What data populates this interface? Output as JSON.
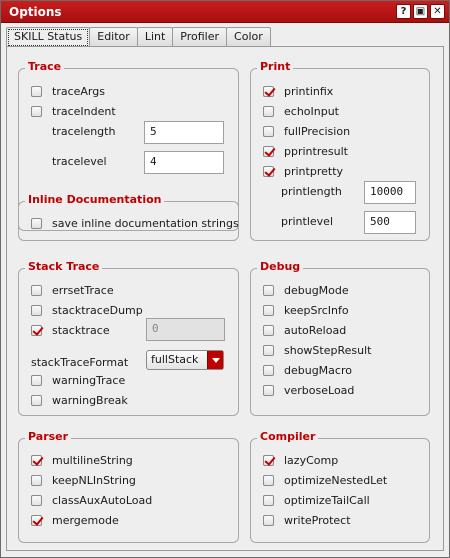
{
  "window": {
    "title": "Options",
    "help_icon": "?",
    "restore_icon": "restore-icon",
    "close_icon": "close-icon"
  },
  "tabs": [
    "SKILL Status",
    "Editor",
    "Lint",
    "Profiler",
    "Color"
  ],
  "trace": {
    "title": "Trace",
    "traceArgs": "traceArgs",
    "traceIndent": "traceIndent",
    "tracelength_label": "tracelength",
    "tracelength_value": "5",
    "tracelevel_label": "tracelevel",
    "tracelevel_value": "4"
  },
  "print": {
    "title": "Print",
    "printinfix": "printinfix",
    "echoInput": "echoInput",
    "fullPrecision": "fullPrecision",
    "pprintresult": "pprintresult",
    "printpretty": "printpretty",
    "printlength_label": "printlength",
    "printlength_value": "10000",
    "printlevel_label": "printlevel",
    "printlevel_value": "500"
  },
  "inline_doc": {
    "title": "Inline Documentation",
    "save": "save inline documentation strings"
  },
  "stack_trace": {
    "title": "Stack Trace",
    "errsetTrace": "errsetTrace",
    "stacktraceDump": "stacktraceDump",
    "stacktrace": "stacktrace",
    "stacktrace_value": "0",
    "format_label": "stackTraceFormat",
    "format_value": "fullStack",
    "warningTrace": "warningTrace",
    "warningBreak": "warningBreak"
  },
  "debug": {
    "title": "Debug",
    "debugMode": "debugMode",
    "keepSrcInfo": "keepSrcInfo",
    "autoReload": "autoReload",
    "showStepResult": "showStepResult",
    "debugMacro": "debugMacro",
    "verboseLoad": "verboseLoad"
  },
  "parser": {
    "title": "Parser",
    "multilineString": "multilineString",
    "keepNLInString": "keepNLInString",
    "classAuxAutoLoad": "classAuxAutoLoad",
    "mergemode": "mergemode"
  },
  "compiler": {
    "title": "Compiler",
    "lazyComp": "lazyComp",
    "optimizeNestedLet": "optimizeNestedLet",
    "optimizeTailCall": "optimizeTailCall",
    "writeProtect": "writeProtect"
  }
}
